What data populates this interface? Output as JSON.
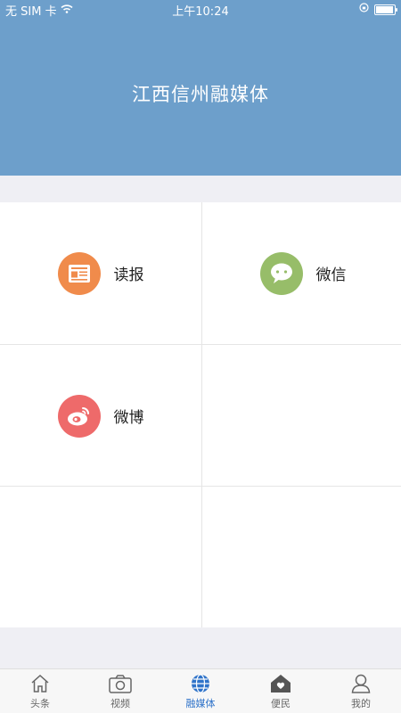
{
  "status": {
    "carrier": "无 SIM 卡",
    "time": "上午10:24"
  },
  "header": {
    "title": "江西信州融媒体"
  },
  "grid": {
    "items": [
      {
        "label": "读报",
        "icon": "newspaper-icon",
        "color": "#f08b4b"
      },
      {
        "label": "微信",
        "icon": "wechat-icon",
        "color": "#97bd69"
      },
      {
        "label": "微博",
        "icon": "weibo-icon",
        "color": "#ee6a6a"
      }
    ]
  },
  "tabbar": {
    "tabs": [
      {
        "label": "头条",
        "icon": "home-icon"
      },
      {
        "label": "视频",
        "icon": "camera-icon"
      },
      {
        "label": "融媒体",
        "icon": "globe-icon",
        "active": true
      },
      {
        "label": "便民",
        "icon": "heart-house-icon"
      },
      {
        "label": "我的",
        "icon": "user-icon"
      }
    ],
    "active_color": "#2f73c9"
  }
}
